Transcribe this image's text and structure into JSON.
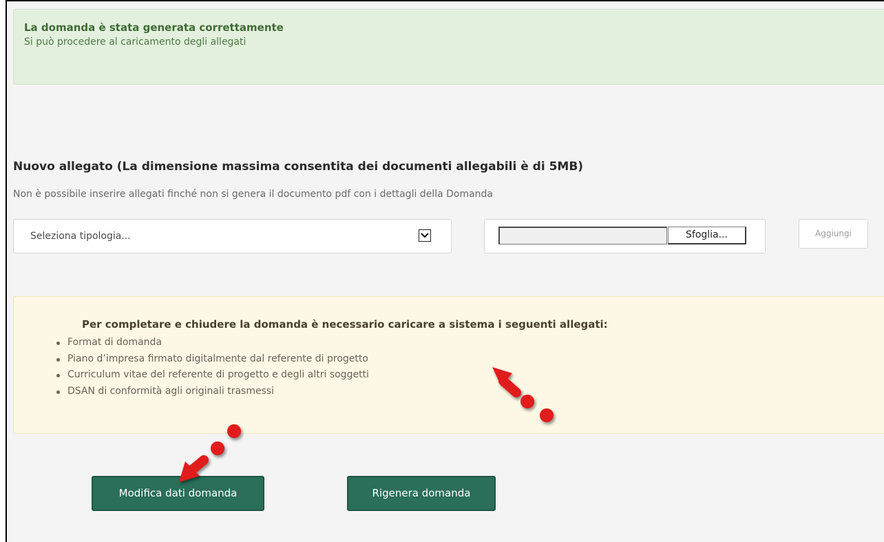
{
  "success": {
    "title": "La domanda è stata generata correttamente",
    "subtitle": "Si può procedere al caricamento degli allegati"
  },
  "attachment": {
    "title": "Nuovo allegato (La dimensione massima consentita dei documenti allegabili è di 5MB)",
    "note": "Non è possibile inserire allegati finché non si genera il documento pdf con i dettagli della Domanda",
    "select_value": "Seleziona tipologia...",
    "browse_label": "Sfoglia...",
    "add_label": "Aggiungi"
  },
  "requirements": {
    "title": "Per completare e chiudere la domanda è necessario caricare a sistema i seguenti allegati:",
    "items": [
      "Format di domanda",
      "Piano d’impresa firmato digitalmente dal referente di progetto",
      "Curriculum vitae del referente di progetto e degli altri soggetti",
      "DSAN di conformità agli originali trasmessi"
    ]
  },
  "actions": {
    "modify_label": "Modifica dati domanda",
    "regenerate_label": "Rigenera domanda"
  },
  "icons": {
    "select_arrow": "chevron-down-icon",
    "annotation": "red-arrow-icon"
  },
  "colors": {
    "primary_button": "#2b6e5a",
    "success_bg": "#e3f0de",
    "warning_bg": "#fdf8e5",
    "annotation": "#e11b1b"
  }
}
